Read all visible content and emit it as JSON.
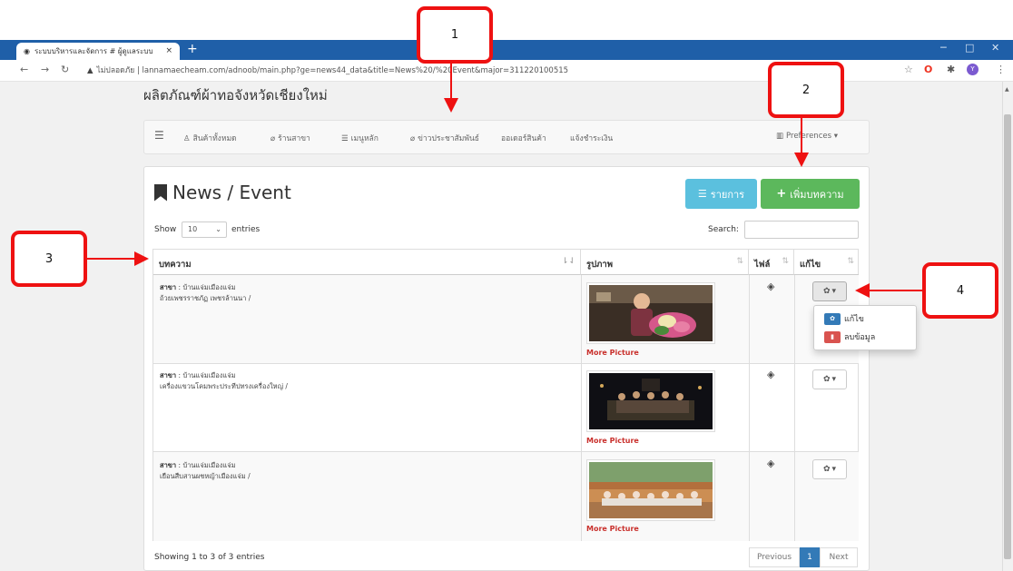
{
  "browser": {
    "tab_title": "ระบบบริหารและจัดการ # ผู้ดูแลระบบ",
    "tab_close": "×",
    "new_tab": "+",
    "security_label": "ไม่ปลอดภัย",
    "url": "lannamaecheam.com/adnoob/main.php?ge=news44_data&title=News%20/%20Event&major=311220100515",
    "win_minimize": "─",
    "win_maximize": "□",
    "win_close": "✕",
    "avatar_letter": "Y"
  },
  "page": {
    "heading": "ผลิตภัณฑ์ผ้าทอจังหวัดเชียงใหม่"
  },
  "navbar": {
    "items": [
      {
        "label": "สินค้าทั้งหมด",
        "icon": "user-icon"
      },
      {
        "label": "ร้านสาขา",
        "icon": "leaf-icon"
      },
      {
        "label": "เมนูหลัก",
        "icon": "list-icon"
      },
      {
        "label": "ข่าวประชาสัมพันธ์",
        "icon": "leaf-icon"
      },
      {
        "label": "ออเดอร์สินค้า",
        "icon": ""
      },
      {
        "label": "แจ้งชำระเงิน",
        "icon": ""
      }
    ],
    "preferences": "Preferences"
  },
  "panel": {
    "title": "News / Event",
    "list_button": "รายการ",
    "add_button": "เพิ่มบทความ",
    "show_label": "Show",
    "entries_value": "10",
    "entries_label": "entries",
    "search_label": "Search:",
    "search_value": ""
  },
  "table": {
    "headers": [
      "บทความ",
      "รูปภาพ",
      "ไฟล์",
      "แก้ไข"
    ],
    "rows": [
      {
        "branch_label": "สาขา",
        "branch": ": บ้านแจ่มเมืองแจ่ม",
        "title": "ถ้วยเพชรราชภัฏ เพชรล้านนา /",
        "more": "More Picture"
      },
      {
        "branch_label": "สาขา",
        "branch": ": บ้านแจ่มเมืองแจ่ม",
        "title": "เครื่องแขวนโคมพระประทีปทรงเครื่องใหญ่ /",
        "more": "More Picture"
      },
      {
        "branch_label": "สาขา",
        "branch": ": บ้านแจ่มเมืองแจ่ม",
        "title": "เยือนสืบสานผชหญ้าเมืองแจ่ม /",
        "more": "More Picture"
      }
    ],
    "dropdown": {
      "edit": "แก้ไข",
      "delete": "ลบข้อมูล"
    },
    "showing": "Showing 1 to 3 of 3 entries",
    "pagination": {
      "previous": "Previous",
      "current": "1",
      "next": "Next"
    }
  },
  "callouts": [
    "1",
    "2",
    "3",
    "4"
  ],
  "colors": {
    "annotation": "#ee1111",
    "info": "#5bc0de",
    "success": "#5cb85c",
    "primary": "#337ab7",
    "danger": "#d9534f",
    "browser": "#1f5fa8"
  }
}
